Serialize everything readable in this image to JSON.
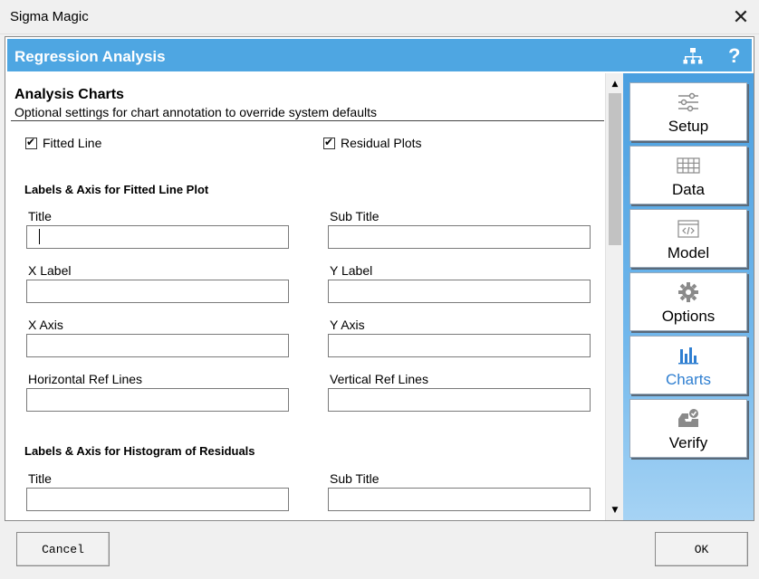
{
  "window": {
    "title": "Sigma Magic"
  },
  "header": {
    "title": "Regression Analysis"
  },
  "section": {
    "title": "Analysis Charts",
    "description": "Optional settings for chart annotation to override system defaults"
  },
  "checkboxes": {
    "fitted_line": {
      "label": "Fitted Line",
      "checked": true
    },
    "residual_plots": {
      "label": "Residual Plots",
      "checked": true
    }
  },
  "fitted_group": {
    "heading": "Labels & Axis for Fitted Line Plot",
    "fields": {
      "title": {
        "label": "Title",
        "value": ""
      },
      "subtitle": {
        "label": "Sub Title",
        "value": ""
      },
      "xlabel": {
        "label": "X Label",
        "value": ""
      },
      "ylabel": {
        "label": "Y Label",
        "value": ""
      },
      "xaxis": {
        "label": "X Axis",
        "value": ""
      },
      "yaxis": {
        "label": "Y Axis",
        "value": ""
      },
      "href": {
        "label": "Horizontal Ref Lines",
        "value": ""
      },
      "vref": {
        "label": "Vertical Ref Lines",
        "value": ""
      }
    }
  },
  "hist_group": {
    "heading": "Labels & Axis for Histogram of Residuals",
    "fields": {
      "title": {
        "label": "Title",
        "value": ""
      },
      "subtitle": {
        "label": "Sub Title",
        "value": ""
      }
    }
  },
  "nav": {
    "setup": "Setup",
    "data": "Data",
    "model": "Model",
    "options": "Options",
    "charts": "Charts",
    "verify": "Verify"
  },
  "footer": {
    "cancel": "Cancel",
    "ok": "OK"
  },
  "colors": {
    "header": "#4ea6e2",
    "active_nav": "#2f7fd1"
  }
}
